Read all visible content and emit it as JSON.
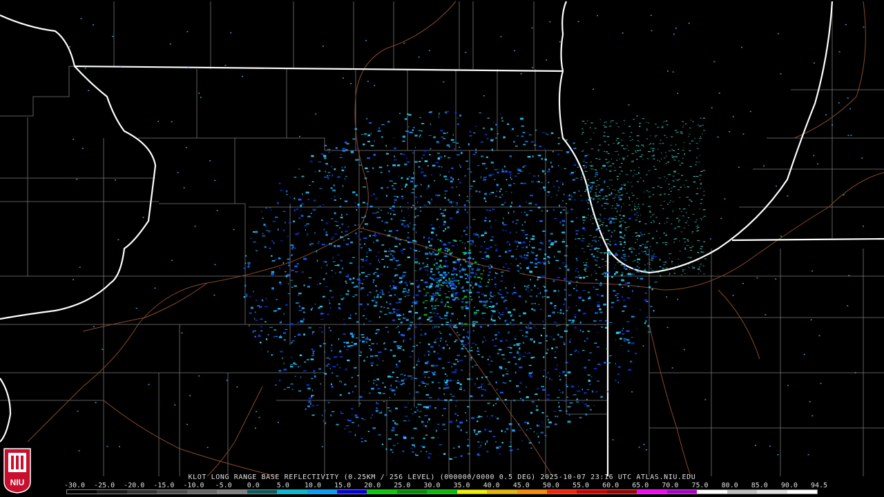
{
  "caption": "KLOT LONG RANGE BASE REFLECTIVITY (0.25KM / 256 LEVEL) (000000/0000 0.5 DEG) 2025-10-07 23:16 UTC  ATLAS.NIU.EDU",
  "scale": {
    "labels": [
      "-30.0",
      "-25.0",
      "-20.0",
      "-15.0",
      "-10.0",
      "-5.0",
      "0.0",
      "5.0",
      "10.0",
      "15.0",
      "20.0",
      "25.0",
      "30.0",
      "35.0",
      "40.0",
      "45.0",
      "50.0",
      "55.0",
      "60.0",
      "65.0",
      "70.0",
      "75.0",
      "80.0",
      "85.0",
      "90.0",
      "94.5"
    ],
    "colors": [
      "#000000",
      "#1a1a1a",
      "#333333",
      "#4d4d4d",
      "#666666",
      "#808080",
      "#0d5c5c",
      "#00bcd4",
      "#00a0ff",
      "#0000e0",
      "#00d000",
      "#009000",
      "#00c000",
      "#f0f000",
      "#e8b800",
      "#ff8c00",
      "#ff2000",
      "#d00000",
      "#a00000",
      "#ff00ff",
      "#b000d0",
      "#ffffff",
      "#c0c0c0",
      "#e0e0e0",
      "#ffffff"
    ]
  },
  "logo": {
    "text": "NIU",
    "color": "#c8102e"
  },
  "radar": {
    "site": "KLOT",
    "product": "Base Reflectivity",
    "colors": [
      "#38d0f0",
      "#1aa0ff",
      "#20b8e8",
      "#1060ff",
      "#0830d0",
      "#40e0d0",
      "#00c020"
    ]
  }
}
